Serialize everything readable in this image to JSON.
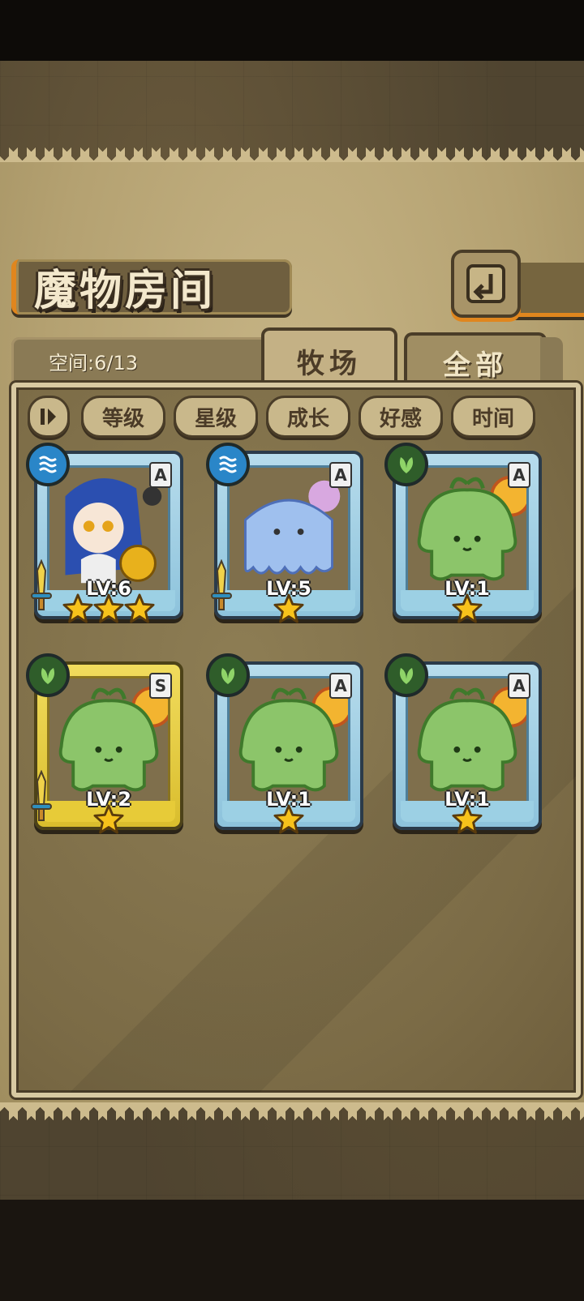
{
  "header": {
    "title": "魔物房间",
    "space_label": "空间:6/13"
  },
  "tabs": [
    {
      "label": "牧场",
      "active": true
    },
    {
      "label": "全部",
      "active": false
    }
  ],
  "sort_buttons": [
    "等级",
    "星级",
    "成长",
    "好感",
    "时间"
  ],
  "cards": [
    {
      "element": "water",
      "rank": "A",
      "level": "LV:6",
      "stars": 3,
      "frame": "blue",
      "creature": "catgirl-mage",
      "weapon": true
    },
    {
      "element": "water",
      "rank": "A",
      "level": "LV:5",
      "stars": 1,
      "frame": "blue",
      "creature": "blue-jellyfish",
      "weapon": true
    },
    {
      "element": "grass",
      "rank": "A",
      "level": "LV:1",
      "stars": 1,
      "frame": "blue",
      "creature": "green-slime-sprout",
      "weapon": false
    },
    {
      "element": "grass",
      "rank": "S",
      "level": "LV:2",
      "stars": 1,
      "frame": "gold",
      "creature": "green-slime-sprout",
      "weapon": true
    },
    {
      "element": "grass",
      "rank": "A",
      "level": "LV:1",
      "stars": 1,
      "frame": "blue",
      "creature": "green-slime-sprout",
      "weapon": false
    },
    {
      "element": "grass",
      "rank": "A",
      "level": "LV:1",
      "stars": 1,
      "frame": "blue",
      "creature": "green-slime-sprout",
      "weapon": false
    }
  ],
  "colors": {
    "accent_orange": "#e0861e",
    "parchment": "#c7b586",
    "water": "#2a86c8",
    "grass": "#2f5d2a"
  }
}
